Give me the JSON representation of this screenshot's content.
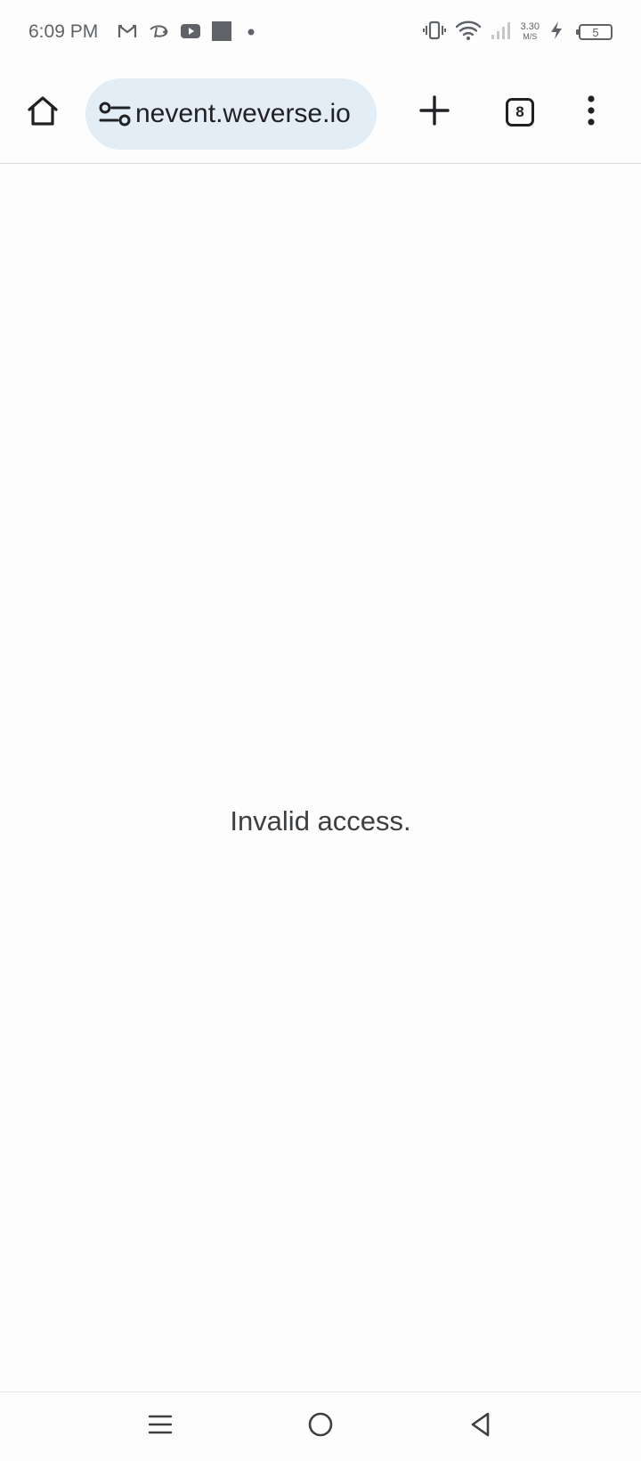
{
  "status_bar": {
    "time": "6:09 PM",
    "left_icons": [
      "gmail-icon",
      "disney-plus-icon",
      "youtube-icon",
      "app-square-icon",
      "notification-dot-icon"
    ],
    "right_icons": [
      "vibrate-icon",
      "wifi-icon",
      "signal-icon",
      "charging-icon"
    ],
    "net_speed_value": "3.30",
    "net_speed_unit": "M/S",
    "battery_level": "5"
  },
  "toolbar": {
    "url": "nevent.weverse.io",
    "tab_count": "8",
    "omnibox_bg": "#e3edf5"
  },
  "page": {
    "message": "Invalid access."
  },
  "nav_bar": {
    "buttons": [
      "recents-icon",
      "home-circle-icon",
      "back-icon"
    ]
  }
}
